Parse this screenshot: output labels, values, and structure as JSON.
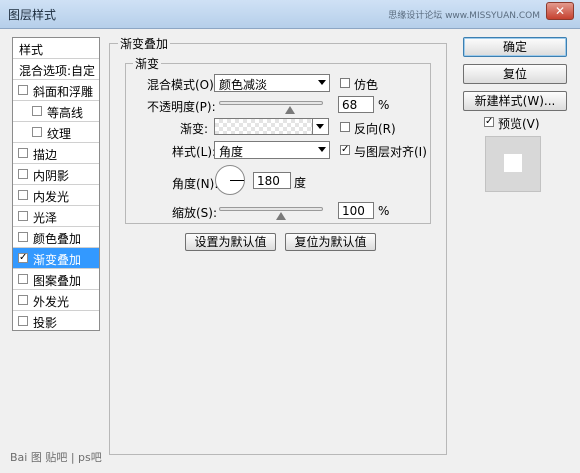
{
  "window": {
    "title": "图层样式",
    "watermark_top": "思缘设计论坛 www.MISSYUAN.COM",
    "close_label": "✕"
  },
  "left_panel": {
    "header": "样式",
    "blend_options": "混合选项:自定",
    "items": [
      {
        "label": "斜面和浮雕",
        "checked": false
      },
      {
        "label": "等高线",
        "checked": false
      },
      {
        "label": "纹理",
        "checked": false
      },
      {
        "label": "描边",
        "checked": false
      },
      {
        "label": "内阴影",
        "checked": false
      },
      {
        "label": "内发光",
        "checked": false
      },
      {
        "label": "光泽",
        "checked": false
      },
      {
        "label": "颜色叠加",
        "checked": false
      },
      {
        "label": "渐变叠加",
        "checked": true
      },
      {
        "label": "图案叠加",
        "checked": false
      },
      {
        "label": "外发光",
        "checked": false
      },
      {
        "label": "投影",
        "checked": false
      }
    ]
  },
  "gradient_overlay": {
    "outer_title": "渐变叠加",
    "inner_title": "渐变",
    "blend_mode_label": "混合模式(O):",
    "blend_mode_value": "颜色减淡",
    "dither_label": "仿色",
    "opacity_label": "不透明度(P):",
    "opacity_value": "68",
    "opacity_percent": 0.68,
    "gradient_label": "渐变:",
    "reverse_label": "反向(R)",
    "style_label": "样式(L):",
    "style_value": "角度",
    "align_label": "与图层对齐(I)",
    "angle_label": "角度(N):",
    "angle_value": "180",
    "angle_unit": "度",
    "scale_label": "缩放(S):",
    "scale_value": "100",
    "percent_sign": "%",
    "make_default": "设置为默认值",
    "reset_default": "复位为默认值"
  },
  "right_buttons": {
    "ok": "确定",
    "reset": "复位",
    "new_style": "新建样式(W)...",
    "preview_label": "预览(V)",
    "preview_checked": true
  },
  "footer": {
    "watermark": "Bai 图 贴吧 | ps吧"
  },
  "colors": {
    "selection": "#3399ff",
    "title_bar": "#b6cfea"
  }
}
